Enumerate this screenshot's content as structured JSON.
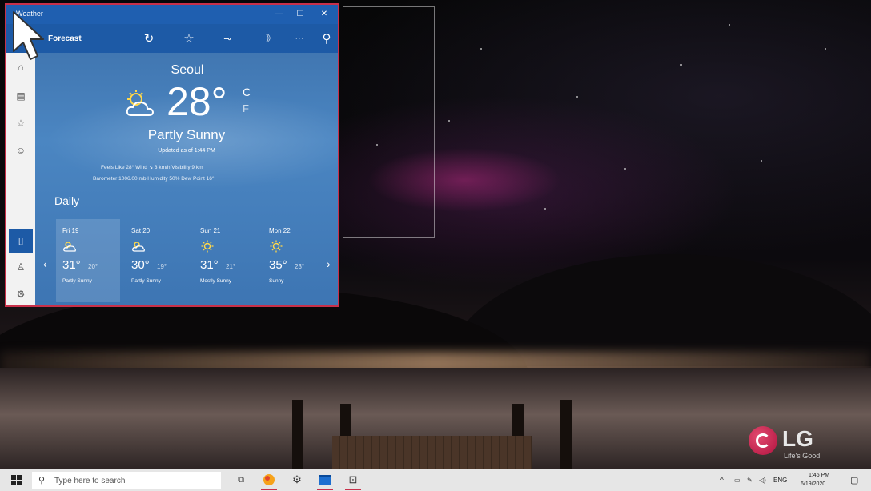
{
  "weather_app": {
    "window_title": "Weather",
    "toolbar_title": "Forecast",
    "city": "Seoul",
    "temperature": "28°",
    "unit_c": "C",
    "unit_f": "F",
    "condition": "Partly Sunny",
    "updated": "Updated as of 1:44 PM",
    "details_line1": "Feels Like  28°     Wind  ↘ 3 km/h     Visibility  9 km",
    "details_line2": "Barometer  1006.00 mb     Humidity  50%     Dew Point  16°",
    "daily_label": "Daily",
    "days": [
      {
        "name": "Fri 19",
        "hi": "31°",
        "lo": "20°",
        "condition": "Partly Sunny",
        "icon": "partly-cloudy-icon"
      },
      {
        "name": "Sat 20",
        "hi": "30°",
        "lo": "19°",
        "condition": "Partly Sunny",
        "icon": "partly-cloudy-icon"
      },
      {
        "name": "Sun 21",
        "hi": "31°",
        "lo": "21°",
        "condition": "Mostly Sunny",
        "icon": "sun-icon"
      },
      {
        "name": "Mon 22",
        "hi": "35°",
        "lo": "23°",
        "condition": "Sunny",
        "icon": "sun-icon"
      }
    ]
  },
  "desktop": {
    "brand": "LG",
    "tagline": "Life's Good"
  },
  "taskbar": {
    "search_placeholder": "Type here to search",
    "language": "ENG",
    "time": "1:46 PM",
    "date": "6/19/2020"
  },
  "colors": {
    "window_border": "#c8304a",
    "titlebar": "#1f5fb0",
    "accent": "#1d5aa6"
  }
}
